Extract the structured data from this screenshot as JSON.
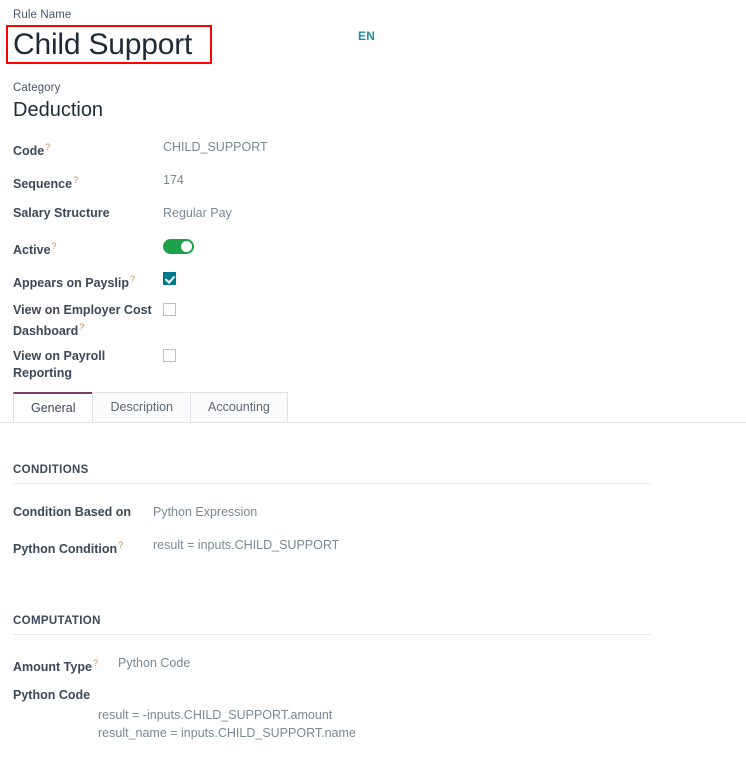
{
  "header": {
    "rule_name_label": "Rule Name",
    "rule_name": "Child Support",
    "language_badge": "EN",
    "category_label": "Category",
    "category_value": "Deduction",
    "highlight_color": "#ff0000",
    "accent_color": "#1a8fa0"
  },
  "fields": [
    {
      "label": "Code",
      "help": "?",
      "value": "CHILD_SUPPORT",
      "type": "text"
    },
    {
      "label": "Sequence",
      "help": "?",
      "value": "174",
      "type": "text"
    },
    {
      "label": "Salary Structure",
      "help": "",
      "value": "Regular Pay",
      "type": "text"
    },
    {
      "label": "Active",
      "help": "?",
      "value": "on",
      "type": "toggle"
    },
    {
      "label": "Appears on Payslip",
      "help": "?",
      "value": "checked",
      "type": "checkbox"
    },
    {
      "label": "View on Employer Cost Dashboard",
      "help": "?",
      "value": "unchecked",
      "type": "checkbox"
    },
    {
      "label": "View on Payroll Reporting",
      "help": "",
      "value": "unchecked",
      "type": "checkbox"
    }
  ],
  "tabs": [
    {
      "label": "General",
      "active": true
    },
    {
      "label": "Description",
      "active": false
    },
    {
      "label": "Accounting",
      "active": false
    }
  ],
  "conditions": {
    "section_title": "CONDITIONS",
    "condition_based_on_label": "Condition Based on",
    "condition_based_on_value": "Python Expression",
    "python_condition_label": "Python Condition",
    "python_condition_help": "?",
    "python_condition_value": "result = inputs.CHILD_SUPPORT"
  },
  "computation": {
    "section_title": "COMPUTATION",
    "amount_type_label": "Amount Type",
    "amount_type_help": "?",
    "amount_type_value": "Python Code",
    "python_code_label": "Python Code",
    "python_code_value": "result = -inputs.CHILD_SUPPORT.amount\nresult_name = inputs.CHILD_SUPPORT.name"
  },
  "theme": {
    "toggle_on_color": "#1da24a",
    "checkbox_checked_color": "#00798c",
    "active_tab_border": "#7d3c6b",
    "help_mark_color": "#c98b4b"
  }
}
